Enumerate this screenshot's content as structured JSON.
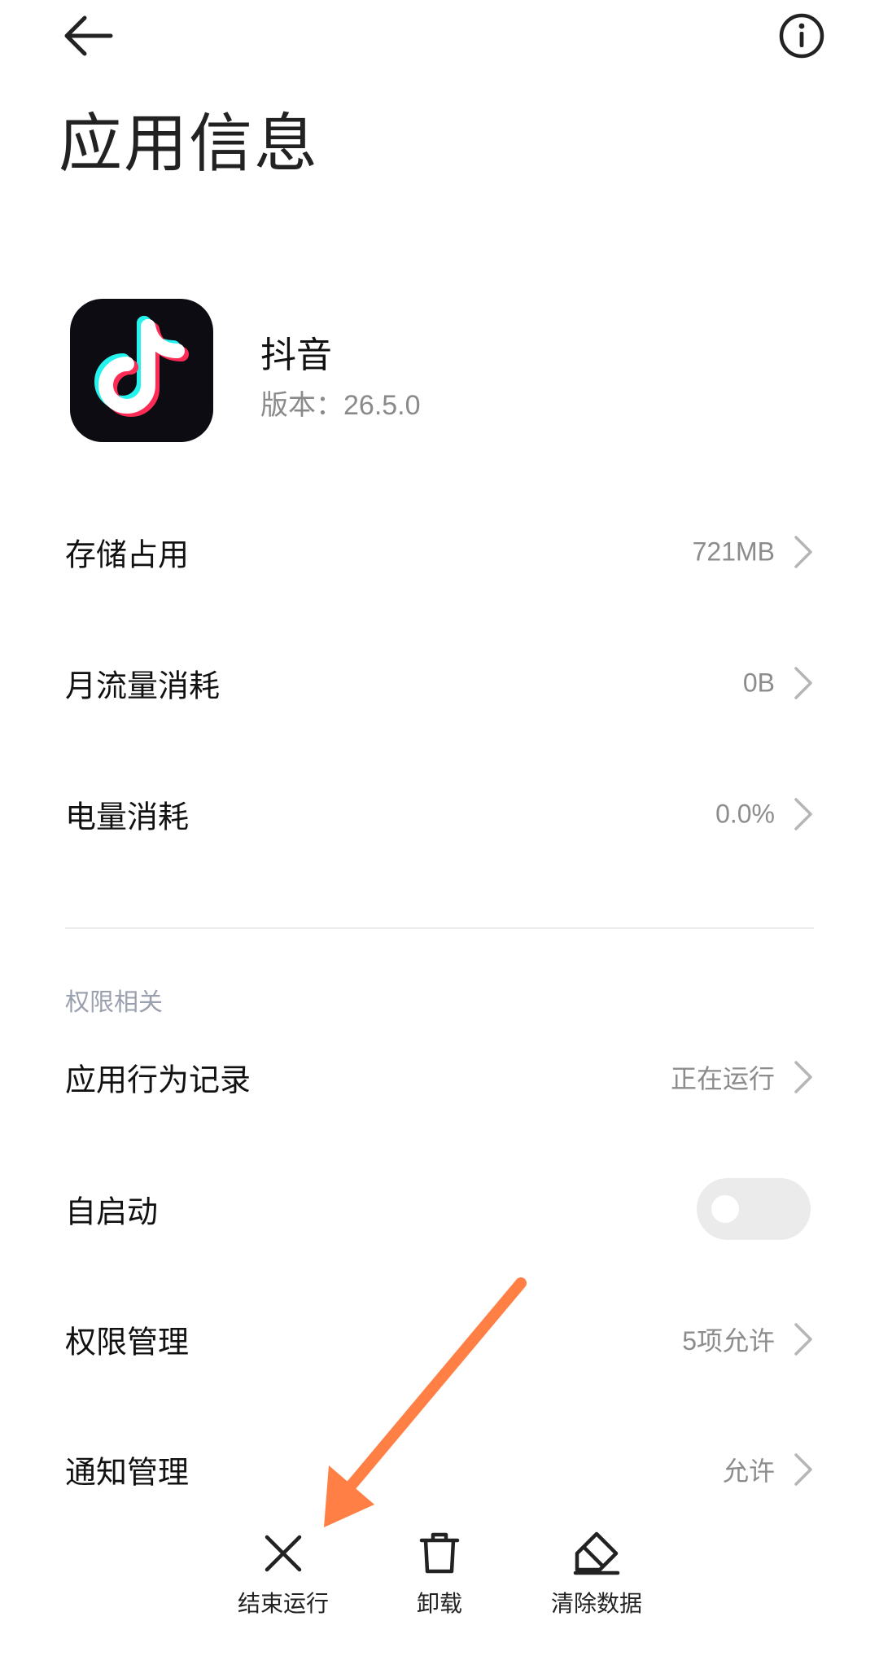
{
  "header": {
    "title": "应用信息",
    "back_icon": "arrow-left-icon",
    "info_icon": "info-circle-icon"
  },
  "app": {
    "name": "抖音",
    "version": "版本：26.5.0",
    "icon": "douyin-logo-icon"
  },
  "usage_rows": [
    {
      "label": "存储占用",
      "value": "721MB"
    },
    {
      "label": "月流量消耗",
      "value": "0B"
    },
    {
      "label": "电量消耗",
      "value": "0.0%"
    }
  ],
  "permissions": {
    "section_title": "权限相关",
    "rows": [
      {
        "label": "应用行为记录",
        "value": "正在运行"
      },
      {
        "label": "自启动",
        "toggle_on": false
      },
      {
        "label": "权限管理",
        "value": "5项允许"
      },
      {
        "label": "通知管理",
        "value": "允许"
      }
    ]
  },
  "actions": [
    {
      "label": "结束运行",
      "icon": "close-icon"
    },
    {
      "label": "卸载",
      "icon": "trash-icon"
    },
    {
      "label": "清除数据",
      "icon": "eraser-icon"
    }
  ],
  "colors": {
    "annotation_arrow": "#FF7F45",
    "secondary_text": "#8C8C8C",
    "section_header": "#9AA0AD",
    "toggle_off": "#EBEBEB"
  }
}
